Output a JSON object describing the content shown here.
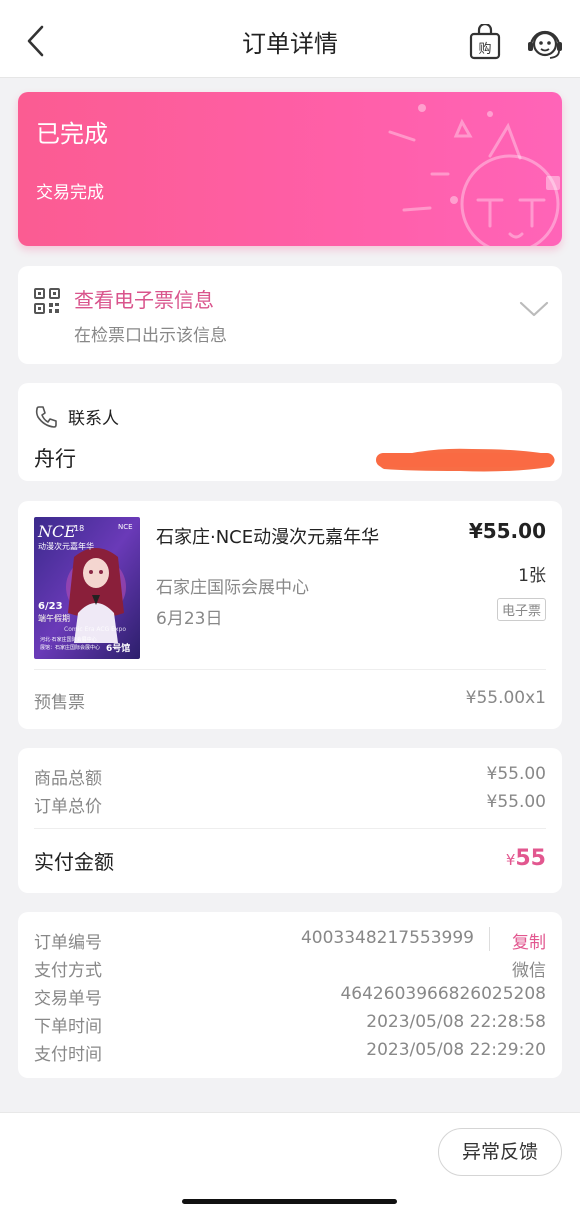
{
  "nav": {
    "title": "订单详情",
    "back_icon": "chevron-left-icon",
    "bag_icon": "shopping-bag-icon",
    "bag_text": "购",
    "service_icon": "customer-service-icon"
  },
  "status": {
    "title": "已完成",
    "subtitle": "交易完成",
    "accent": "#fb5c92"
  },
  "eticket": {
    "title": "查看电子票信息",
    "subtitle": "在检票口出示该信息",
    "accent": "#d9548c"
  },
  "contact": {
    "label": "联系人",
    "name": "舟行"
  },
  "product": {
    "name": "石家庄·NCE动漫次元嘉年华",
    "price": "¥55.00",
    "venue": "石家庄国际会展中心",
    "quantity": "1张",
    "date": "6月23日",
    "tag": "电子票",
    "ticket_type": "预售票",
    "ticket_price": "¥55.00x1",
    "poster": {
      "logo": "NCE",
      "logo_num": "18",
      "logo_sub": "动漫次元嘉年华",
      "corner": "NCE",
      "date_text": "6/23",
      "date_tag": "端午假期",
      "expo": "Comic Era ACG Expo",
      "venue_line1": "河北·石家庄国际会展中心",
      "venue_line2": "展馆：石家庄国际会展中心",
      "hall": "6号馆"
    }
  },
  "summary": {
    "goods_total_label": "商品总额",
    "goods_total": "¥55.00",
    "order_total_label": "订单总价",
    "order_total": "¥55.00",
    "paid_label": "实付金额",
    "paid_currency": "¥",
    "paid_amount": "55"
  },
  "order_info": {
    "order_no_label": "订单编号",
    "order_no": "4003348217553999",
    "copy": "复制",
    "pay_method_label": "支付方式",
    "pay_method": "微信",
    "trade_no_label": "交易单号",
    "trade_no": "4642603966826025208",
    "order_time_label": "下单时间",
    "order_time": "2023/05/08 22:28:58",
    "pay_time_label": "支付时间",
    "pay_time": "2023/05/08 22:29:20"
  },
  "footer": {
    "feedback": "异常反馈"
  }
}
